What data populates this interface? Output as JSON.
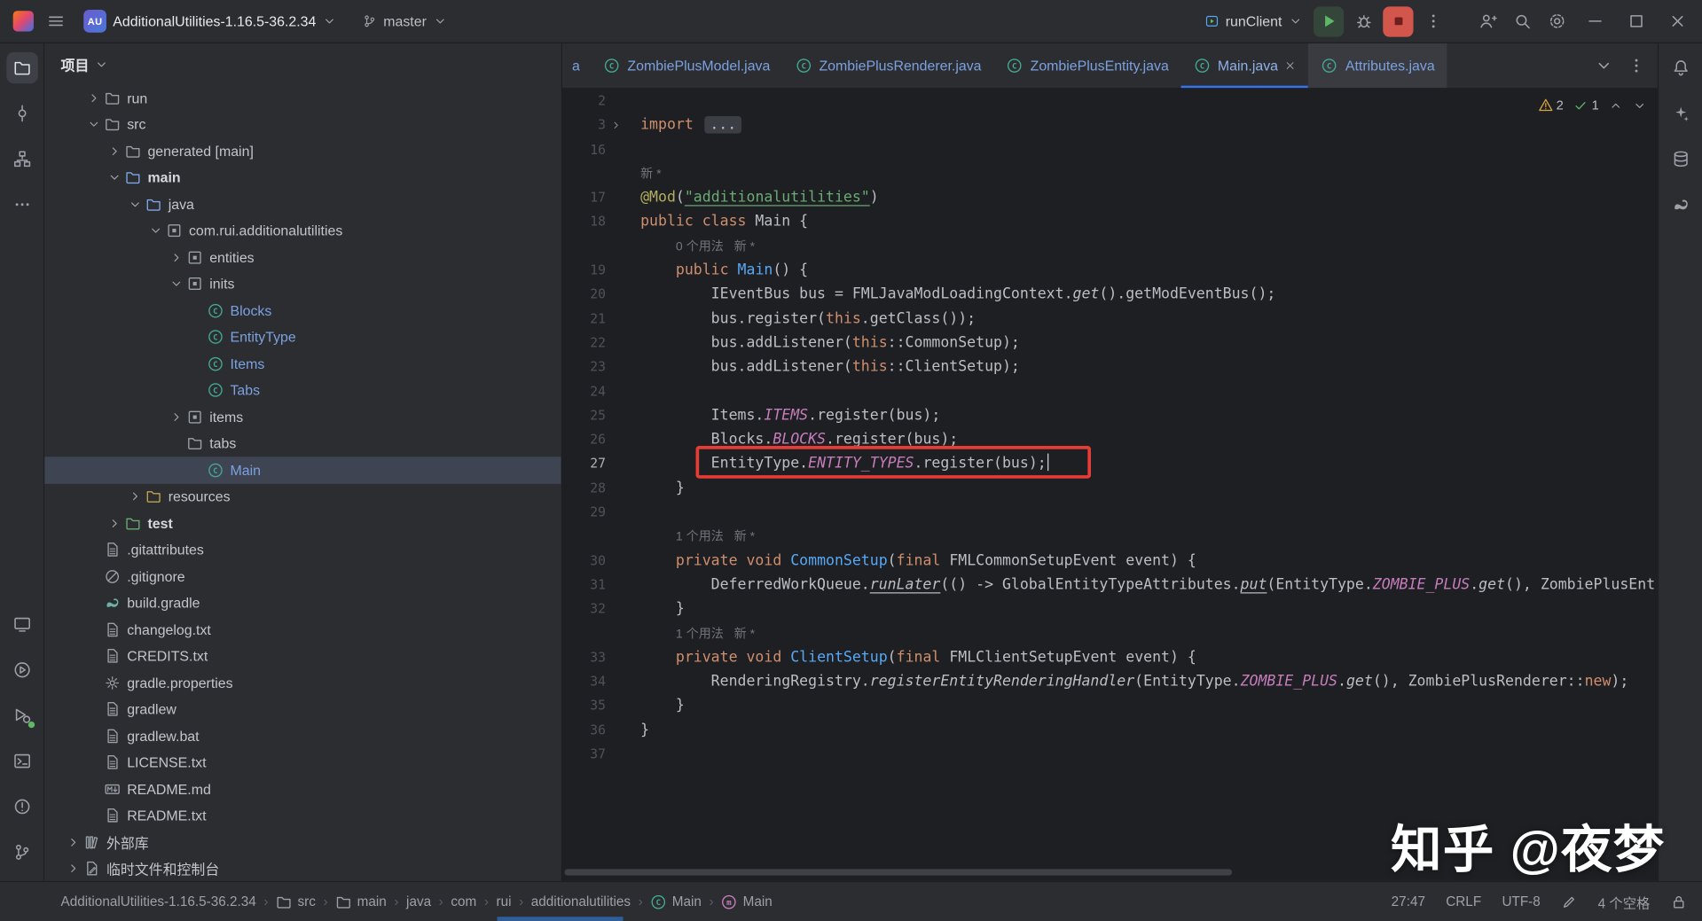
{
  "titlebar": {
    "project_badge": "AU",
    "project_name": "AdditionalUtilities-1.16.5-36.2.34",
    "branch": "master",
    "run_config": "runClient"
  },
  "project_panel": {
    "header": "项目",
    "tree": [
      {
        "label": "run",
        "indent": 2,
        "chevron": "collapsed",
        "icon": "folder"
      },
      {
        "label": "src",
        "indent": 2,
        "chevron": "expanded",
        "icon": "folder"
      },
      {
        "label": "generated [main]",
        "indent": 3,
        "chevron": "collapsed",
        "icon": "folder"
      },
      {
        "label": "main",
        "indent": 3,
        "chevron": "expanded",
        "icon": "folder",
        "icon_color": "source",
        "bold": true
      },
      {
        "label": "java",
        "indent": 4,
        "chevron": "expanded",
        "icon": "folder",
        "icon_color": "source"
      },
      {
        "label": "com.rui.additionalutilities",
        "indent": 5,
        "chevron": "expanded",
        "icon": "package"
      },
      {
        "label": "entities",
        "indent": 6,
        "chevron": "collapsed",
        "icon": "package"
      },
      {
        "label": "inits",
        "indent": 6,
        "chevron": "expanded",
        "icon": "package"
      },
      {
        "label": "Blocks",
        "indent": 7,
        "icon": "class",
        "modified": true
      },
      {
        "label": "EntityType",
        "indent": 7,
        "icon": "class",
        "modified": true
      },
      {
        "label": "Items",
        "indent": 7,
        "icon": "class",
        "modified": true
      },
      {
        "label": "Tabs",
        "indent": 7,
        "icon": "class",
        "modified": true
      },
      {
        "label": "items",
        "indent": 6,
        "chevron": "collapsed",
        "icon": "package"
      },
      {
        "label": "tabs",
        "indent": 6,
        "icon": "folder"
      },
      {
        "label": "Main",
        "indent": 7,
        "icon": "class",
        "modified": true,
        "selected": true
      },
      {
        "label": "resources",
        "indent": 4,
        "chevron": "collapsed",
        "icon": "folder",
        "icon_color": "resources"
      },
      {
        "label": "test",
        "indent": 3,
        "chevron": "collapsed",
        "icon": "folder",
        "icon_color": "test",
        "bold": true
      },
      {
        "label": ".gitattributes",
        "indent": 2,
        "icon": "text-file"
      },
      {
        "label": ".gitignore",
        "indent": 2,
        "icon": "ignored-file"
      },
      {
        "label": "build.gradle",
        "indent": 2,
        "icon": "gradle-file"
      },
      {
        "label": "changelog.txt",
        "indent": 2,
        "icon": "text-file"
      },
      {
        "label": "CREDITS.txt",
        "indent": 2,
        "icon": "text-file"
      },
      {
        "label": "gradle.properties",
        "indent": 2,
        "icon": "properties-file"
      },
      {
        "label": "gradlew",
        "indent": 2,
        "icon": "text-file"
      },
      {
        "label": "gradlew.bat",
        "indent": 2,
        "icon": "text-file"
      },
      {
        "label": "LICENSE.txt",
        "indent": 2,
        "icon": "text-file"
      },
      {
        "label": "README.md",
        "indent": 2,
        "icon": "markdown-file"
      },
      {
        "label": "README.txt",
        "indent": 2,
        "icon": "text-file"
      },
      {
        "label": "外部库",
        "indent": 1,
        "chevron": "collapsed",
        "icon": "library"
      },
      {
        "label": "临时文件和控制台",
        "indent": 1,
        "chevron": "collapsed",
        "icon": "scratch"
      }
    ]
  },
  "tabs": [
    {
      "label": "a",
      "partial": true
    },
    {
      "label": "ZombiePlusModel.java",
      "icon": "class"
    },
    {
      "label": "ZombiePlusRenderer.java",
      "icon": "class"
    },
    {
      "label": "ZombiePlusEntity.java",
      "icon": "class"
    },
    {
      "label": "Main.java",
      "icon": "class",
      "active": true,
      "close": true
    },
    {
      "label": "Attributes.java",
      "icon": "class",
      "preview": true
    }
  ],
  "editor": {
    "inspections": {
      "warnings": "2",
      "passed": "1"
    },
    "lines": [
      {
        "n": "2",
        "t": []
      },
      {
        "n": "3",
        "fold": true,
        "t": [
          [
            "k",
            "import "
          ],
          [
            "fd",
            "..."
          ]
        ]
      },
      {
        "n": "16",
        "t": []
      },
      {
        "inlay": "新 *",
        "ind": 0
      },
      {
        "n": "17",
        "t": [
          [
            "an",
            "@Mod"
          ],
          [
            "d",
            "("
          ],
          [
            "su",
            "\"additionalutilities\""
          ],
          [
            "d",
            ")"
          ]
        ]
      },
      {
        "n": "18",
        "t": [
          [
            "k",
            "public class "
          ],
          [
            "d",
            "Main {"
          ]
        ]
      },
      {
        "inlay": "0 个用法   新 *",
        "ind": 4
      },
      {
        "n": "19",
        "t": [
          [
            "d",
            "    "
          ],
          [
            "k",
            "public "
          ],
          [
            "me",
            "Main"
          ],
          [
            "d",
            "() {"
          ]
        ]
      },
      {
        "n": "20",
        "t": [
          [
            "d",
            "        IEventBus bus = FMLJavaModLoadingContext."
          ],
          [
            "it",
            "get"
          ],
          [
            "d",
            "().getModEventBus();"
          ]
        ]
      },
      {
        "n": "21",
        "t": [
          [
            "d",
            "        bus.register("
          ],
          [
            "k",
            "this"
          ],
          [
            "d",
            ".getClass());"
          ]
        ]
      },
      {
        "n": "22",
        "t": [
          [
            "d",
            "        bus.addListener("
          ],
          [
            "k",
            "this"
          ],
          [
            "d",
            "::CommonSetup);"
          ]
        ]
      },
      {
        "n": "23",
        "t": [
          [
            "d",
            "        bus.addListener("
          ],
          [
            "k",
            "this"
          ],
          [
            "d",
            "::ClientSetup);"
          ]
        ]
      },
      {
        "n": "24",
        "t": []
      },
      {
        "n": "25",
        "t": [
          [
            "d",
            "        Items."
          ],
          [
            "sf",
            "ITEMS"
          ],
          [
            "d",
            ".register(bus);"
          ]
        ]
      },
      {
        "n": "26",
        "t": [
          [
            "d",
            "        Blocks."
          ],
          [
            "sf",
            "BLOCKS"
          ],
          [
            "d",
            ".register(bus);"
          ]
        ]
      },
      {
        "n": "27",
        "current": true,
        "box": true,
        "caret": true,
        "t": [
          [
            "d",
            "        EntityType."
          ],
          [
            "sf",
            "ENTITY_TYPES"
          ],
          [
            "d",
            ".register(bus);"
          ]
        ]
      },
      {
        "n": "28",
        "t": [
          [
            "d",
            "    }"
          ]
        ]
      },
      {
        "n": "29",
        "t": []
      },
      {
        "inlay": "1 个用法   新 *",
        "ind": 4
      },
      {
        "n": "30",
        "t": [
          [
            "d",
            "    "
          ],
          [
            "k",
            "private void "
          ],
          [
            "me",
            "CommonSetup"
          ],
          [
            "d",
            "("
          ],
          [
            "k",
            "final "
          ],
          [
            "d",
            "FMLCommonSetupEvent event) {"
          ]
        ]
      },
      {
        "n": "31",
        "t": [
          [
            "d",
            "        DeferredWorkQueue."
          ],
          [
            "itu",
            "runLater"
          ],
          [
            "d",
            "(() -> GlobalEntityTypeAttributes."
          ],
          [
            "itu",
            "put"
          ],
          [
            "d",
            "(EntityType."
          ],
          [
            "sf",
            "ZOMBIE_PLUS"
          ],
          [
            "d",
            "."
          ],
          [
            "it",
            "get"
          ],
          [
            "d",
            "(), ZombiePlusEnt"
          ]
        ]
      },
      {
        "n": "32",
        "t": [
          [
            "d",
            "    }"
          ]
        ]
      },
      {
        "inlay": "1 个用法   新 *",
        "ind": 4
      },
      {
        "n": "33",
        "t": [
          [
            "d",
            "    "
          ],
          [
            "k",
            "private void "
          ],
          [
            "me",
            "ClientSetup"
          ],
          [
            "d",
            "("
          ],
          [
            "k",
            "final "
          ],
          [
            "d",
            "FMLClientSetupEvent event) {"
          ]
        ]
      },
      {
        "n": "34",
        "t": [
          [
            "d",
            "        RenderingRegistry."
          ],
          [
            "it",
            "registerEntityRenderingHandler"
          ],
          [
            "d",
            "(EntityType."
          ],
          [
            "sf",
            "ZOMBIE_PLUS"
          ],
          [
            "d",
            "."
          ],
          [
            "it",
            "get"
          ],
          [
            "d",
            "(), ZombiePlusRenderer::"
          ],
          [
            "k",
            "new"
          ],
          [
            "d",
            ");"
          ]
        ]
      },
      {
        "n": "35",
        "t": [
          [
            "d",
            "    }"
          ]
        ]
      },
      {
        "n": "36",
        "t": [
          [
            "d",
            "}"
          ]
        ]
      },
      {
        "n": "37",
        "t": []
      }
    ]
  },
  "breadcrumbs": [
    {
      "label": "AdditionalUtilities-1.16.5-36.2.34"
    },
    {
      "label": "src",
      "icon": "folder"
    },
    {
      "label": "main",
      "icon": "folder"
    },
    {
      "label": "java"
    },
    {
      "label": "com"
    },
    {
      "label": "rui"
    },
    {
      "label": "additionalutilities"
    },
    {
      "label": "Main",
      "icon": "class"
    },
    {
      "label": "Main",
      "icon": "method"
    }
  ],
  "status_bar": {
    "cursor_position": "27:47",
    "line_separator": "CRLF",
    "encoding": "UTF-8",
    "indent": "4 个空格"
  },
  "watermark": {
    "text": "知乎 @夜梦"
  },
  "colors": {
    "accent": "#3574f0",
    "annotation_box": "#e53c35",
    "warning": "#d9a343",
    "success": "#5fb865",
    "stop_button": "#d3564d",
    "modified_file": "#7ca1e0",
    "editor_bg": "#1e1f22",
    "panel_bg": "#2b2d30"
  }
}
